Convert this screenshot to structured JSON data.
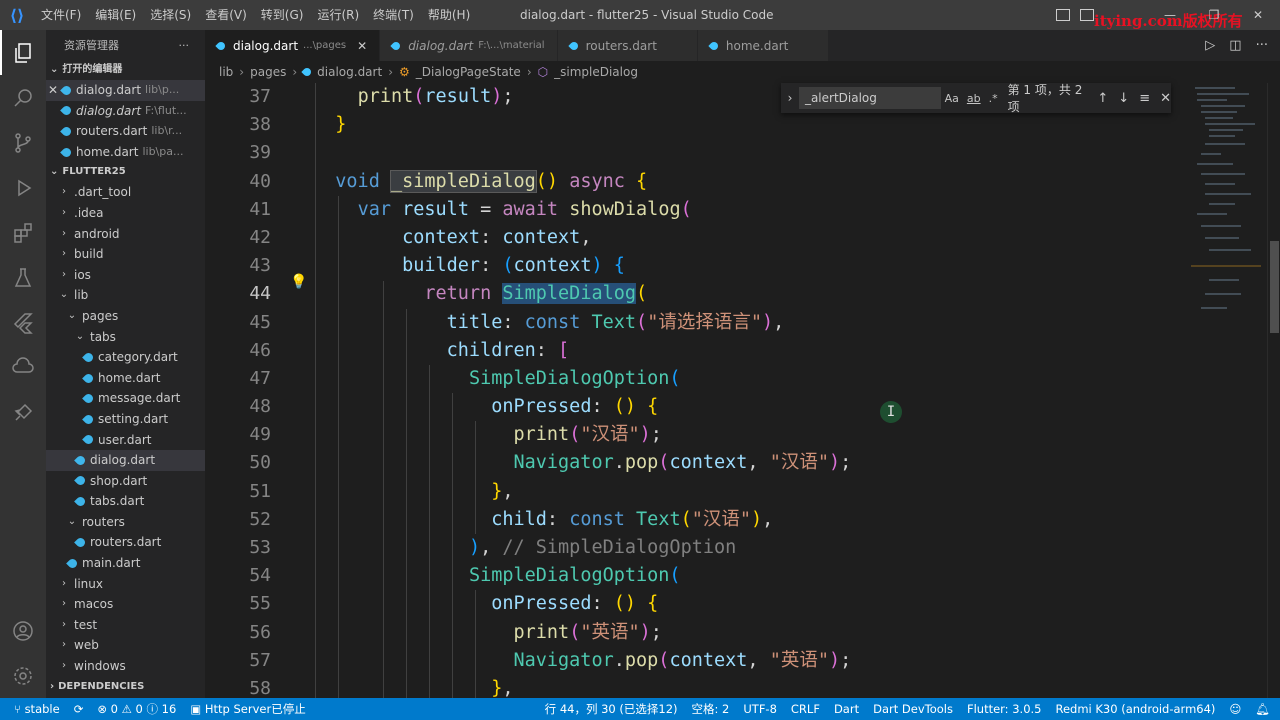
{
  "titlebar": {
    "menus": [
      "文件(F)",
      "编辑(E)",
      "选择(S)",
      "查看(V)",
      "转到(G)",
      "运行(R)",
      "终端(T)",
      "帮助(H)"
    ],
    "title": "dialog.dart - flutter25 - Visual Studio Code",
    "watermark": "itying.com版权所有"
  },
  "sidebar": {
    "header": "资源管理器",
    "open_editors_label": "打开的编辑器",
    "open_editors": [
      {
        "name": "dialog.dart",
        "path": "lib\\p..."
      },
      {
        "name": "dialog.dart",
        "path": "F:\\flut..."
      },
      {
        "name": "routers.dart",
        "path": "lib\\r..."
      },
      {
        "name": "home.dart",
        "path": "lib\\pa..."
      }
    ],
    "project_label": "FLUTTER25",
    "tree": [
      ".dart_tool",
      ".idea",
      "android",
      "build",
      "ios",
      "lib",
      "pages",
      "tabs",
      "category.dart",
      "home.dart",
      "message.dart",
      "setting.dart",
      "user.dart",
      "dialog.dart",
      "shop.dart",
      "tabs.dart",
      "routers",
      "routers.dart",
      "main.dart",
      "linux",
      "macos",
      "test",
      "web",
      "windows"
    ],
    "dependencies_label": "DEPENDENCIES"
  },
  "tabs": [
    {
      "name": "dialog.dart",
      "path": "...\\pages"
    },
    {
      "name": "dialog.dart",
      "path": "F:\\...\\material"
    },
    {
      "name": "routers.dart",
      "path": ""
    },
    {
      "name": "home.dart",
      "path": ""
    }
  ],
  "breadcrumb": [
    "lib",
    "pages",
    "dialog.dart",
    "_DialogPageState",
    "_simpleDialog"
  ],
  "find": {
    "query": "_alertDialog",
    "opt_case": "Aa",
    "opt_word": "ab",
    "opt_regex": ".*",
    "count": "第 1 项，共 2 项"
  },
  "editor": {
    "line_numbers": [
      "37",
      "38",
      "39",
      "40",
      "41",
      "42",
      "43",
      "44",
      "45",
      "46",
      "47",
      "48",
      "49",
      "50",
      "51",
      "52",
      "53",
      "54",
      "55",
      "56",
      "57",
      "58"
    ],
    "current_line": "44",
    "strings": {
      "s45": "\"请选择语言\"",
      "s49": "\"汉语\"",
      "s50": "\"汉语\"",
      "s52": "\"汉语\"",
      "s56": "\"英语\"",
      "s57": "\"英语\"",
      "c53": "// SimpleDialogOption"
    }
  },
  "statusbar": {
    "branch": "stable",
    "problems": "⊗ 0 ⚠ 0 ⓘ 16",
    "server": "Http Server已停止",
    "position": "行 44，列 30 (已选择12)",
    "spaces": "空格: 2",
    "encoding": "UTF-8",
    "eol": "CRLF",
    "language": "Dart",
    "devtools": "Dart DevTools",
    "flutter": "Flutter: 3.0.5",
    "device": "Redmi K30 (android-arm64)"
  }
}
